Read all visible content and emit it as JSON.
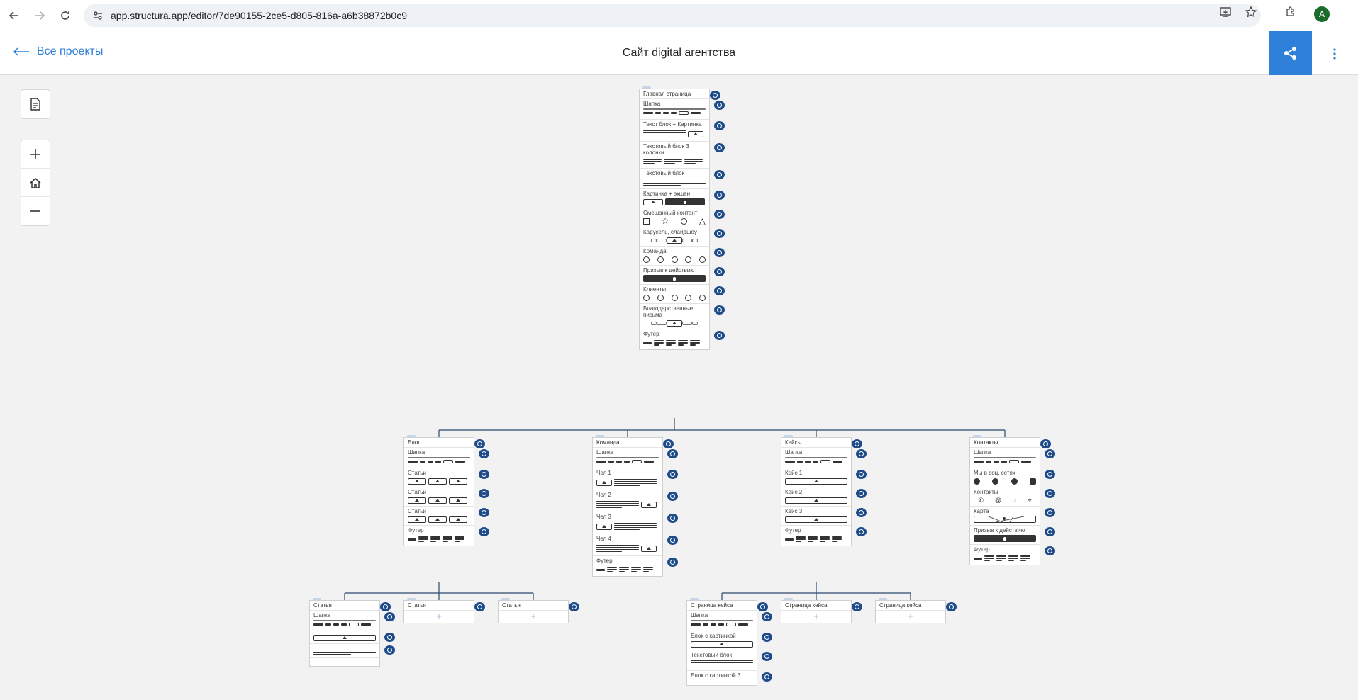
{
  "browser": {
    "url": "app.structura.app/editor/7de90155-2ce5-d805-816a-a6b38872b0c9",
    "avatar_letter": "A"
  },
  "header": {
    "back_label": "Все проекты",
    "title": "Сайт digital агентства"
  },
  "colors": {
    "accent": "#2f80d8",
    "bubble": "#1e4b8a",
    "edge": "#2c4a6e"
  },
  "tools": [
    "document-icon",
    "zoom-in-icon",
    "home-icon",
    "zoom-out-icon"
  ],
  "sitemap": {
    "home": {
      "title": "Главная страница",
      "blocks": [
        {
          "label": "Шапка",
          "preview": "header"
        },
        {
          "label": "Текст блок + Картинка",
          "preview": "text-image"
        },
        {
          "label": "Текстовый блок 3 колонки",
          "preview": "three-columns"
        },
        {
          "label": "Текстовый блок",
          "preview": "text"
        },
        {
          "label": "Картинка + экшен",
          "preview": "image-action"
        },
        {
          "label": "Смешанный контент",
          "preview": "mixed"
        },
        {
          "label": "Карусель, слайдшоу",
          "preview": "carousel"
        },
        {
          "label": "Команда",
          "preview": "circles"
        },
        {
          "label": "Призыв к действию",
          "preview": "cta"
        },
        {
          "label": "Клиенты",
          "preview": "circles"
        },
        {
          "label": "Благодарственные письма",
          "preview": "carousel"
        },
        {
          "label": "Футер",
          "preview": "footer"
        }
      ]
    },
    "blog": {
      "title": "Блог",
      "blocks": [
        {
          "label": "Шапка",
          "preview": "header"
        },
        {
          "label": "Статьи",
          "preview": "three-images"
        },
        {
          "label": "Статьи",
          "preview": "three-images"
        },
        {
          "label": "Статьи",
          "preview": "three-images"
        },
        {
          "label": "Футер",
          "preview": "footer"
        }
      ]
    },
    "team": {
      "title": "Команда",
      "blocks": [
        {
          "label": "Шапка",
          "preview": "header"
        },
        {
          "label": "Чел 1",
          "preview": "image-text"
        },
        {
          "label": "Чел 2",
          "preview": "text-image"
        },
        {
          "label": "Чел 3",
          "preview": "image-text"
        },
        {
          "label": "Чел 4",
          "preview": "text-image"
        },
        {
          "label": "Футер",
          "preview": "footer"
        }
      ]
    },
    "cases": {
      "title": "Кейсы",
      "blocks": [
        {
          "label": "Шапка",
          "preview": "header"
        },
        {
          "label": "Кейс 1",
          "preview": "wide-image"
        },
        {
          "label": "Кейс 2",
          "preview": "wide-image"
        },
        {
          "label": "Кейс 3",
          "preview": "wide-image"
        },
        {
          "label": "Футер",
          "preview": "footer"
        }
      ]
    },
    "contacts": {
      "title": "Контакты",
      "blocks": [
        {
          "label": "Шапка",
          "preview": "header"
        },
        {
          "label": "Мы в соц. сетях",
          "preview": "social"
        },
        {
          "label": "Контакты",
          "preview": "contacts"
        },
        {
          "label": "Карта",
          "preview": "map"
        },
        {
          "label": "Призыв к действию",
          "preview": "cta"
        },
        {
          "label": "Футер",
          "preview": "footer"
        }
      ]
    },
    "article1": {
      "title": "Статья",
      "blocks": [
        {
          "label": "Шапка",
          "preview": "header"
        },
        {
          "label": "",
          "preview": "wide-image"
        },
        {
          "label": "",
          "preview": "text"
        },
        {
          "label": "",
          "preview": "empty"
        }
      ]
    },
    "article2": {
      "title": "Статья"
    },
    "article3": {
      "title": "Статья"
    },
    "casepage1": {
      "title": "Страница кейса",
      "blocks": [
        {
          "label": "Шапка",
          "preview": "header"
        },
        {
          "label": "Блок с картинкой",
          "preview": "wide-image"
        },
        {
          "label": "Текстовый блок",
          "preview": "text"
        },
        {
          "label": "Блок с картинкой 3",
          "preview": "empty"
        }
      ]
    },
    "casepage2": {
      "title": "Страница кейса"
    },
    "casepage3": {
      "title": "Страница кейса"
    }
  }
}
